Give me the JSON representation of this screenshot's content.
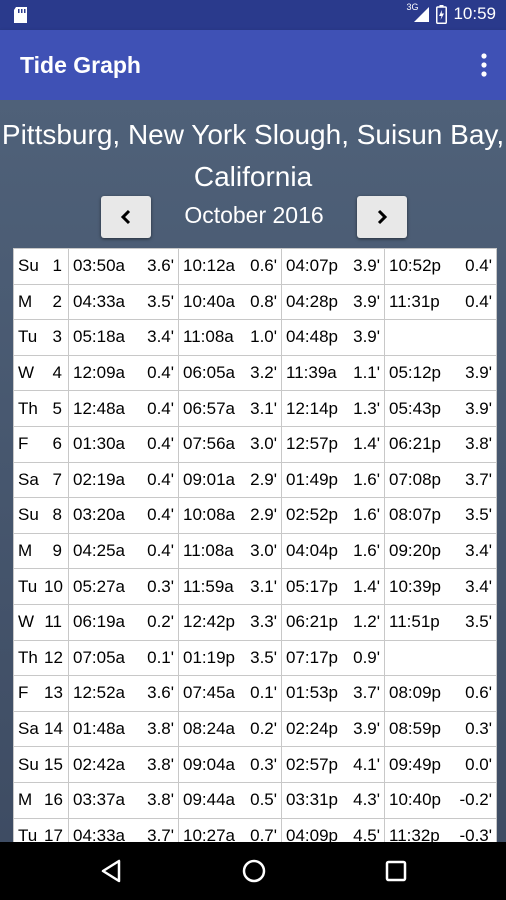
{
  "status": {
    "time": "10:59",
    "network": "3G"
  },
  "app": {
    "title": "Tide Graph"
  },
  "location": "Pittsburg, New York Slough, Suisun Bay, California",
  "month": "October 2016",
  "colors": {
    "high": "#1a1ad6",
    "low": "#000000",
    "negative": "#e01010",
    "appbar": "#3f51b5"
  },
  "rows": [
    {
      "day": "Su",
      "num": "1",
      "cells": [
        {
          "time": "03:50a",
          "h": "3.6'",
          "type": "high"
        },
        {
          "time": "10:12a",
          "h": "0.6'",
          "type": "low"
        },
        {
          "time": "04:07p",
          "h": "3.9'",
          "type": "high"
        },
        {
          "time": "10:52p",
          "h": "0.4'",
          "type": "low"
        }
      ]
    },
    {
      "day": "M",
      "num": "2",
      "cells": [
        {
          "time": "04:33a",
          "h": "3.5'",
          "type": "high"
        },
        {
          "time": "10:40a",
          "h": "0.8'",
          "type": "low"
        },
        {
          "time": "04:28p",
          "h": "3.9'",
          "type": "high"
        },
        {
          "time": "11:31p",
          "h": "0.4'",
          "type": "low"
        }
      ]
    },
    {
      "day": "Tu",
      "num": "3",
      "cells": [
        {
          "time": "05:18a",
          "h": "3.4'",
          "type": "high"
        },
        {
          "time": "11:08a",
          "h": "1.0'",
          "type": "low"
        },
        {
          "time": "04:48p",
          "h": "3.9'",
          "type": "high"
        },
        {
          "time": "",
          "h": "",
          "type": "low"
        }
      ]
    },
    {
      "day": "W",
      "num": "4",
      "cells": [
        {
          "time": "12:09a",
          "h": "0.4'",
          "type": "low"
        },
        {
          "time": "06:05a",
          "h": "3.2'",
          "type": "high"
        },
        {
          "time": "11:39a",
          "h": "1.1'",
          "type": "low"
        },
        {
          "time": "05:12p",
          "h": "3.9'",
          "type": "high"
        }
      ]
    },
    {
      "day": "Th",
      "num": "5",
      "cells": [
        {
          "time": "12:48a",
          "h": "0.4'",
          "type": "low"
        },
        {
          "time": "06:57a",
          "h": "3.1'",
          "type": "high"
        },
        {
          "time": "12:14p",
          "h": "1.3'",
          "type": "low"
        },
        {
          "time": "05:43p",
          "h": "3.9'",
          "type": "high"
        }
      ]
    },
    {
      "day": "F",
      "num": "6",
      "cells": [
        {
          "time": "01:30a",
          "h": "0.4'",
          "type": "low"
        },
        {
          "time": "07:56a",
          "h": "3.0'",
          "type": "high"
        },
        {
          "time": "12:57p",
          "h": "1.4'",
          "type": "low"
        },
        {
          "time": "06:21p",
          "h": "3.8'",
          "type": "high"
        }
      ]
    },
    {
      "day": "Sa",
      "num": "7",
      "cells": [
        {
          "time": "02:19a",
          "h": "0.4'",
          "type": "low"
        },
        {
          "time": "09:01a",
          "h": "2.9'",
          "type": "high"
        },
        {
          "time": "01:49p",
          "h": "1.6'",
          "type": "low"
        },
        {
          "time": "07:08p",
          "h": "3.7'",
          "type": "high"
        }
      ]
    },
    {
      "day": "Su",
      "num": "8",
      "cells": [
        {
          "time": "03:20a",
          "h": "0.4'",
          "type": "low"
        },
        {
          "time": "10:08a",
          "h": "2.9'",
          "type": "high"
        },
        {
          "time": "02:52p",
          "h": "1.6'",
          "type": "low"
        },
        {
          "time": "08:07p",
          "h": "3.5'",
          "type": "high"
        }
      ]
    },
    {
      "day": "M",
      "num": "9",
      "cells": [
        {
          "time": "04:25a",
          "h": "0.4'",
          "type": "low"
        },
        {
          "time": "11:08a",
          "h": "3.0'",
          "type": "high"
        },
        {
          "time": "04:04p",
          "h": "1.6'",
          "type": "low"
        },
        {
          "time": "09:20p",
          "h": "3.4'",
          "type": "high"
        }
      ]
    },
    {
      "day": "Tu",
      "num": "10",
      "cells": [
        {
          "time": "05:27a",
          "h": "0.3'",
          "type": "low"
        },
        {
          "time": "11:59a",
          "h": "3.1'",
          "type": "high"
        },
        {
          "time": "05:17p",
          "h": "1.4'",
          "type": "low"
        },
        {
          "time": "10:39p",
          "h": "3.4'",
          "type": "high"
        }
      ]
    },
    {
      "day": "W",
      "num": "11",
      "cells": [
        {
          "time": "06:19a",
          "h": "0.2'",
          "type": "low"
        },
        {
          "time": "12:42p",
          "h": "3.3'",
          "type": "high"
        },
        {
          "time": "06:21p",
          "h": "1.2'",
          "type": "low"
        },
        {
          "time": "11:51p",
          "h": "3.5'",
          "type": "high"
        }
      ]
    },
    {
      "day": "Th",
      "num": "12",
      "cells": [
        {
          "time": "07:05a",
          "h": "0.1'",
          "type": "low"
        },
        {
          "time": "01:19p",
          "h": "3.5'",
          "type": "high"
        },
        {
          "time": "07:17p",
          "h": "0.9'",
          "type": "low"
        },
        {
          "time": "",
          "h": "",
          "type": "low"
        }
      ]
    },
    {
      "day": "F",
      "num": "13",
      "cells": [
        {
          "time": "12:52a",
          "h": "3.6'",
          "type": "high"
        },
        {
          "time": "07:45a",
          "h": "0.1'",
          "type": "low"
        },
        {
          "time": "01:53p",
          "h": "3.7'",
          "type": "high"
        },
        {
          "time": "08:09p",
          "h": "0.6'",
          "type": "low"
        }
      ]
    },
    {
      "day": "Sa",
      "num": "14",
      "cells": [
        {
          "time": "01:48a",
          "h": "3.8'",
          "type": "high"
        },
        {
          "time": "08:24a",
          "h": "0.2'",
          "type": "low"
        },
        {
          "time": "02:24p",
          "h": "3.9'",
          "type": "high"
        },
        {
          "time": "08:59p",
          "h": "0.3'",
          "type": "low"
        }
      ]
    },
    {
      "day": "Su",
      "num": "15",
      "cells": [
        {
          "time": "02:42a",
          "h": "3.8'",
          "type": "high"
        },
        {
          "time": "09:04a",
          "h": "0.3'",
          "type": "low"
        },
        {
          "time": "02:57p",
          "h": "4.1'",
          "type": "high"
        },
        {
          "time": "09:49p",
          "h": "0.0'",
          "type": "low"
        }
      ]
    },
    {
      "day": "M",
      "num": "16",
      "cells": [
        {
          "time": "03:37a",
          "h": "3.8'",
          "type": "high"
        },
        {
          "time": "09:44a",
          "h": "0.5'",
          "type": "low"
        },
        {
          "time": "03:31p",
          "h": "4.3'",
          "type": "high"
        },
        {
          "time": "10:40p",
          "h": "-0.2'",
          "type": "neg"
        }
      ]
    },
    {
      "day": "Tu",
      "num": "17",
      "cells": [
        {
          "time": "04:33a",
          "h": "3.7'",
          "type": "high"
        },
        {
          "time": "10:27a",
          "h": "0.7'",
          "type": "low"
        },
        {
          "time": "04:09p",
          "h": "4.5'",
          "type": "high"
        },
        {
          "time": "11:32p",
          "h": "-0.3'",
          "type": "neg"
        }
      ]
    }
  ]
}
